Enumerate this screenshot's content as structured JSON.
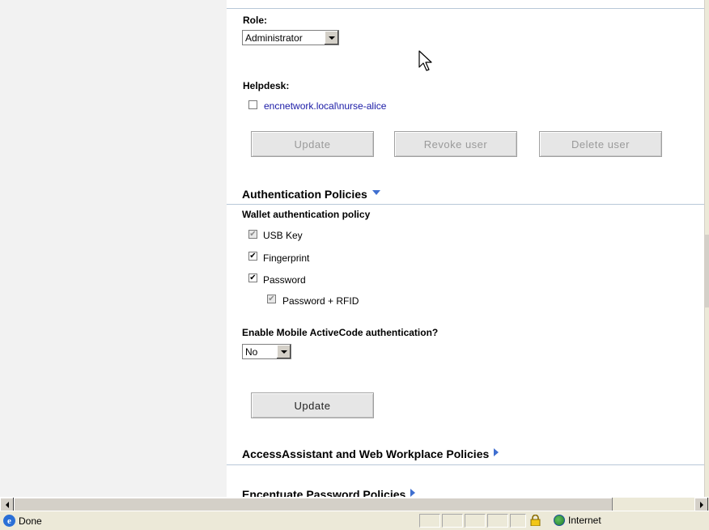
{
  "role": {
    "label": "Role:",
    "selected": "Administrator"
  },
  "helpdesk": {
    "label": "Helpdesk:",
    "user": "encnetwork.local\\nurse-alice",
    "checked": false
  },
  "user_buttons": {
    "update": "Update",
    "revoke": "Revoke user",
    "delete": "Delete user"
  },
  "auth_policies": {
    "title": "Authentication Policies",
    "wallet_label": "Wallet authentication policy",
    "options": [
      {
        "label": "USB Key",
        "checked": true,
        "disabled": true
      },
      {
        "label": "Fingerprint",
        "checked": true,
        "disabled": false
      },
      {
        "label": "Password",
        "checked": true,
        "disabled": false
      },
      {
        "label": "Password + RFID",
        "checked": true,
        "disabled": true
      }
    ],
    "mobile_label": "Enable Mobile ActiveCode authentication?",
    "mobile_selected": "No",
    "update": "Update"
  },
  "access_assistant": {
    "title": "AccessAssistant and Web Workplace Policies"
  },
  "next_section": {
    "title": "Encentuate Password Policies"
  },
  "statusbar": {
    "status": "Done",
    "zone": "Internet"
  },
  "colors": {
    "accent": "#3f6fd0",
    "link": "#1a1aa6",
    "rule": "#b8c8d8",
    "chrome": "#ece9d8"
  },
  "icons": [
    "ie-icon",
    "lock-icon",
    "globe-icon",
    "cursor-icon",
    "chevron-down-icon",
    "chevron-right-icon"
  ]
}
